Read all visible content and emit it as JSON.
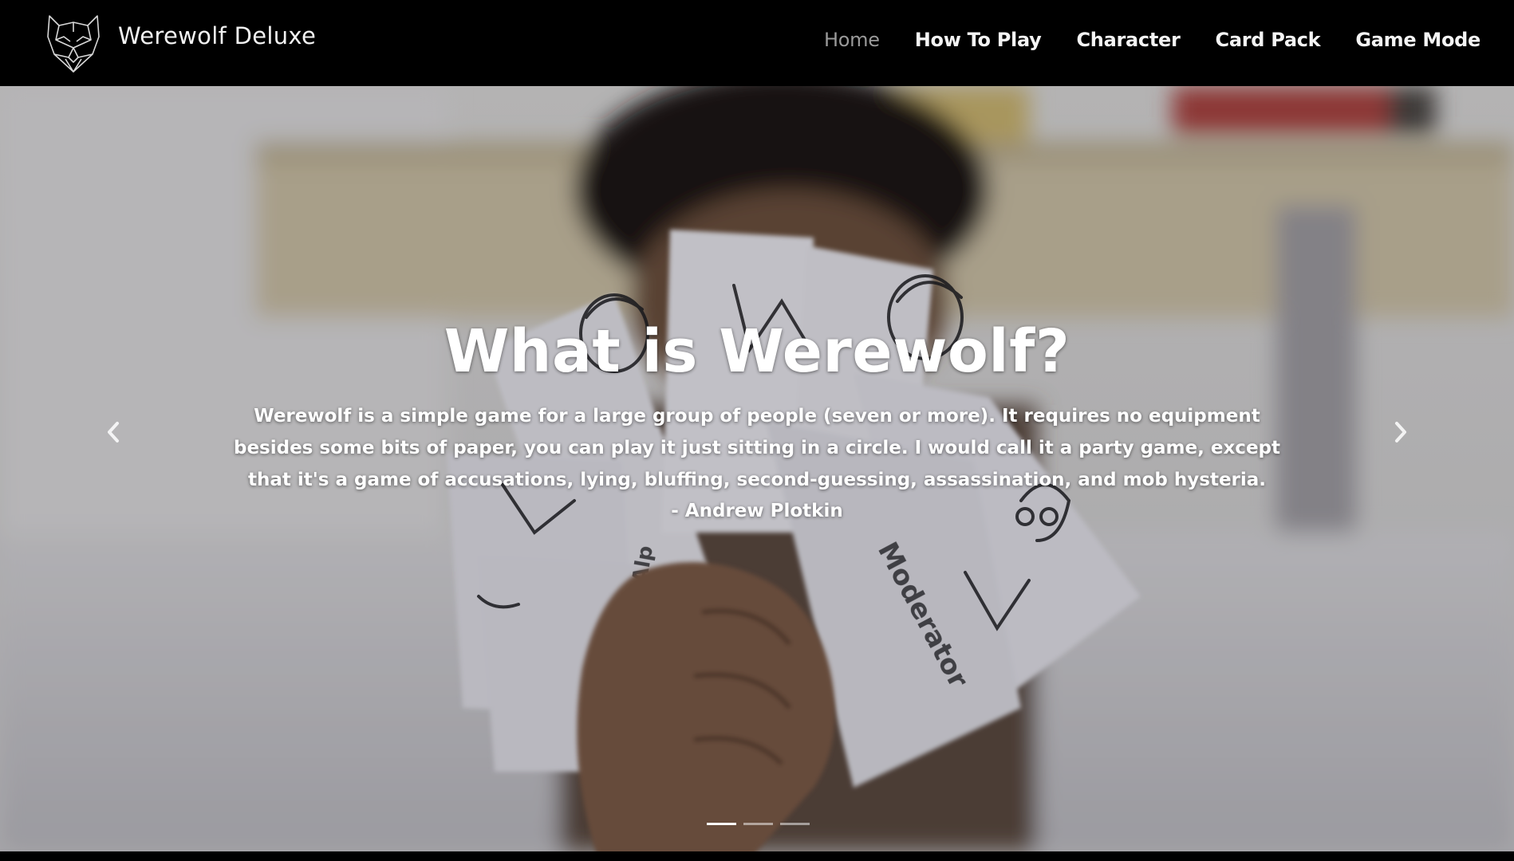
{
  "navbar": {
    "brand_name": "Werewolf Deluxe",
    "brand_icon": "wolf-head-icon",
    "links": [
      {
        "label": "Home",
        "active": true
      },
      {
        "label": "How To Play",
        "active": false
      },
      {
        "label": "Character",
        "active": false
      },
      {
        "label": "Card Pack",
        "active": false
      },
      {
        "label": "Game Mode",
        "active": false
      }
    ]
  },
  "hero": {
    "title": "What is Werewolf?",
    "quote": "Werewolf is a simple game for a large group of people (seven or more). It requires no equipment besides some bits of paper, you can play it just sitting in a circle. I would call it a party game, except that it's a game of accusations, lying, bluffing, second-guessing, assassination, and mob hysteria.",
    "author": "- Andrew Plotkin",
    "prev_icon": "chevron-left-icon",
    "next_icon": "chevron-right-icon",
    "slide_count": 3,
    "active_slide": 1
  },
  "colors": {
    "navbar_bg": "#000000",
    "nav_text": "#f4f4f4",
    "nav_active": "#9a9a9a",
    "caption_text": "#ffffff"
  }
}
